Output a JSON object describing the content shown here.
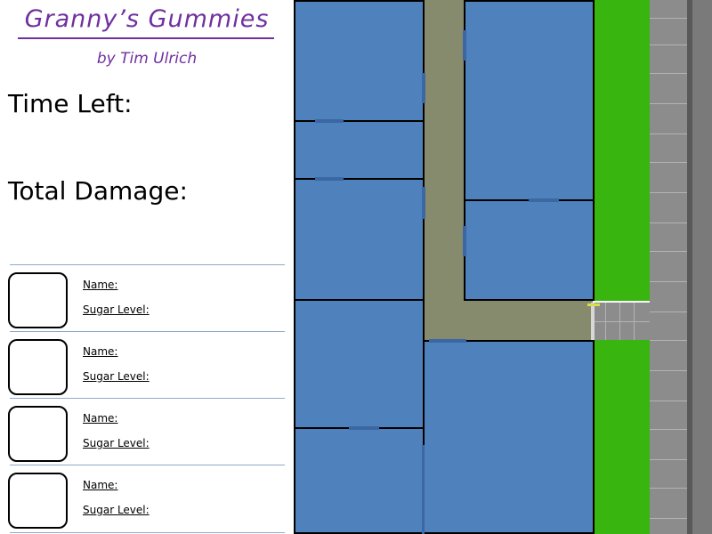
{
  "header": {
    "title": "Granny’s Gummies",
    "author": "by Tim Ulrich"
  },
  "stats": {
    "time_left_label": "Time Left:",
    "total_damage_label": "Total Damage:"
  },
  "slots": [
    {
      "name_label": "Name:",
      "sugar_label": "Sugar Level:"
    },
    {
      "name_label": "Name:",
      "sugar_label": "Sugar Level:"
    },
    {
      "name_label": "Name:",
      "sugar_label": "Sugar Level:"
    },
    {
      "name_label": "Name:",
      "sugar_label": "Sugar Level:"
    }
  ],
  "colors": {
    "title": "#7030a0",
    "room": "#4f81bd",
    "hallway": "#878b6e",
    "grass": "#38b50e",
    "street": "#8c8c8c"
  }
}
